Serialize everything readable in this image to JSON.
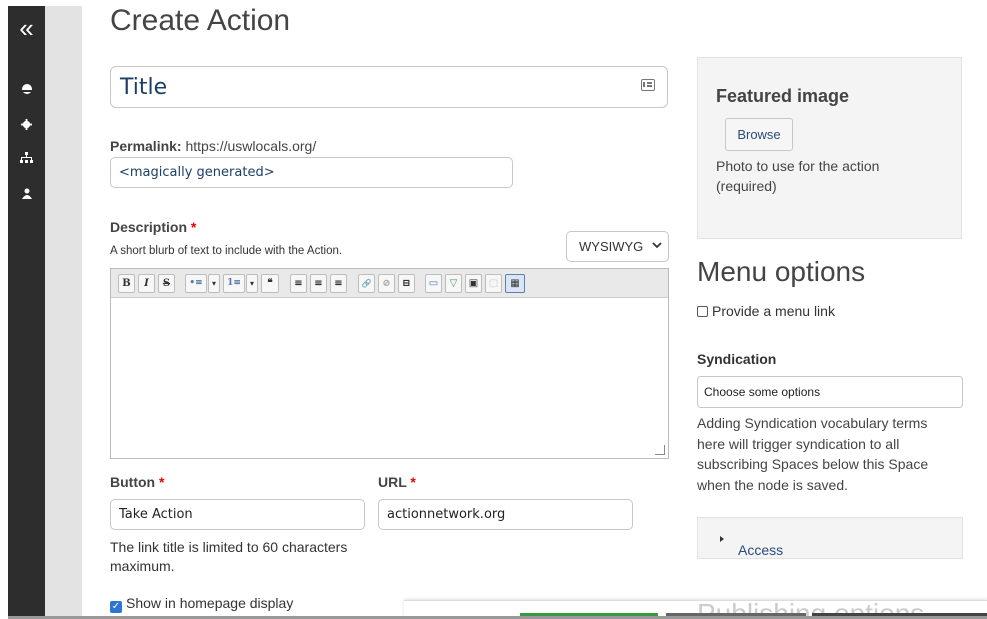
{
  "sidebar": {
    "collapse_glyph": "«",
    "icons": [
      "home-icon",
      "gear-icon",
      "sitemap-icon",
      "user-icon"
    ]
  },
  "page": {
    "title": "Create Action"
  },
  "form": {
    "title_value": "Title",
    "permalink_label": "Permalink:",
    "permalink_base": "https://uswlocals.org/",
    "permalink_value": "<magically generated>",
    "description_label": "Description",
    "description_help": "A short blurb of text to include with the Action.",
    "format_selected": "WYSIWYG",
    "button_label": "Button",
    "button_value": "Take Action",
    "url_label": "URL",
    "url_value": "actionnetwork.org",
    "button_help": "The link title is limited to 60 characters maximum.",
    "homepage_label": "Show in homepage display",
    "required_marker": "*"
  },
  "editor_toolbar": [
    "B",
    "I",
    "S",
    "•≡",
    "▾",
    "1≡",
    "▾",
    "❝",
    "≡",
    "≡",
    "≡",
    "🔗",
    "⊘",
    "⊟",
    "▭",
    "▽",
    "▣",
    "▢",
    "▦"
  ],
  "right": {
    "featured_title": "Featured image",
    "browse_label": "Browse",
    "featured_help": "Photo to use for the action (required)",
    "menu_options_title": "Menu options",
    "menu_link_label": "Provide a menu link",
    "syndication_label": "Syndication",
    "syndication_placeholder": "Choose some options",
    "syndication_help": "Adding Syndication vocabulary terms here will trigger syndication to all subscribing Spaces below this Space when the node is saved.",
    "access_label": "Access",
    "publishing_title": "Publishing options"
  },
  "colors": {
    "accent_blue": "#2f74d0",
    "required_red": "#e00000",
    "save_green": "#3a9a44"
  }
}
